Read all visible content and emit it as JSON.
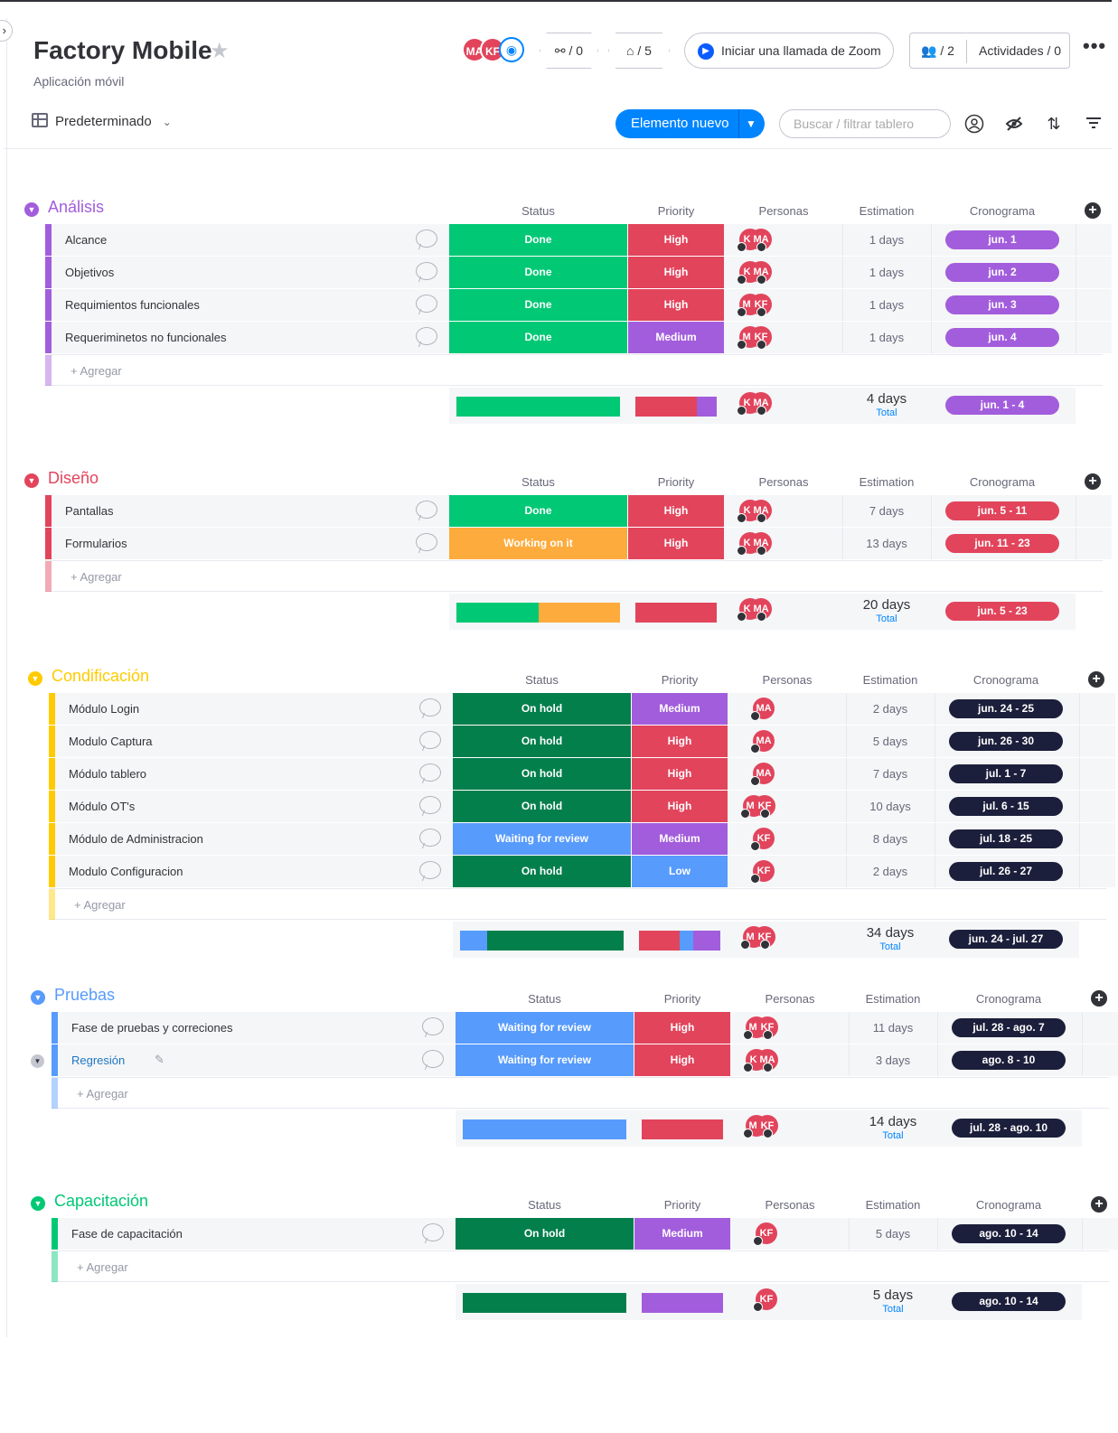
{
  "header": {
    "title": "Factory Mobile",
    "subtitle": "Aplicación móvil",
    "avatars": [
      "MA",
      "KF"
    ],
    "integrations_count": "/ 0",
    "automations_count": "/ 5",
    "zoom_label": "Iniciar una llamada de Zoom",
    "members_label": "/ 2",
    "activity_label": "Actividades / 0",
    "view_label": "Predeterminado",
    "new_item_label": "Elemento nuevo",
    "search_placeholder": "Buscar / filtrar tablero"
  },
  "columns": {
    "status": "Status",
    "priority": "Priority",
    "people": "Personas",
    "estimation": "Estimation",
    "timeline": "Cronograma"
  },
  "add_label": "+ Agregar",
  "total_label": "Total",
  "colors": {
    "done": "#00c875",
    "working": "#fdab3d",
    "onhold": "#037f4c",
    "review": "#579bfc",
    "high": "#e2445c",
    "medium": "#a25ddc",
    "low": "#579bfc",
    "group_purple": "#a25ddc",
    "group_red": "#e2445c",
    "group_yellow": "#ffcb00",
    "group_blue": "#579bfc",
    "group_green": "#00c875",
    "tl_dark": "#1c1f3b",
    "accent": "#0085ff"
  },
  "groups": [
    {
      "name": "Análisis",
      "items": [
        {
          "name": "Alcance",
          "status": "Done",
          "priority": "High",
          "people": [
            "KF",
            "MA"
          ],
          "estimation": "1 days",
          "timeline": "jun. 1"
        },
        {
          "name": "Objetivos",
          "status": "Done",
          "priority": "High",
          "people": [
            "KF",
            "MA"
          ],
          "estimation": "1 days",
          "timeline": "jun. 2"
        },
        {
          "name": "Requimientos funcionales",
          "status": "Done",
          "priority": "High",
          "people": [
            "MA",
            "KF"
          ],
          "estimation": "1 days",
          "timeline": "jun. 3"
        },
        {
          "name": "Requeriminetos no funcionales",
          "status": "Done",
          "priority": "Medium",
          "people": [
            "MA",
            "KF"
          ],
          "estimation": "1 days",
          "timeline": "jun. 4"
        }
      ],
      "summary": {
        "people": [
          "KF",
          "MA"
        ],
        "estimation": "4 days",
        "timeline": "jun. 1 - 4",
        "status_dist": [
          {
            "label": "Done",
            "fraction": 1.0
          }
        ],
        "priority_dist": [
          {
            "label": "High",
            "fraction": 0.75
          },
          {
            "label": "Medium",
            "fraction": 0.25
          }
        ]
      }
    },
    {
      "name": "Diseño",
      "items": [
        {
          "name": "Pantallas",
          "status": "Done",
          "priority": "High",
          "people": [
            "KF",
            "MA"
          ],
          "estimation": "7 days",
          "timeline": "jun. 5 - 11"
        },
        {
          "name": "Formularios",
          "status": "Working on it",
          "priority": "High",
          "people": [
            "KF",
            "MA"
          ],
          "estimation": "13 days",
          "timeline": "jun. 11 - 23"
        }
      ],
      "summary": {
        "people": [
          "KF",
          "MA"
        ],
        "estimation": "20 days",
        "timeline": "jun. 5 - 23",
        "status_dist": [
          {
            "label": "Done",
            "fraction": 0.5
          },
          {
            "label": "Working on it",
            "fraction": 0.5
          }
        ],
        "priority_dist": [
          {
            "label": "High",
            "fraction": 1.0
          }
        ]
      }
    },
    {
      "name": "Condificación",
      "items": [
        {
          "name": "Módulo Login",
          "status": "On hold",
          "priority": "Medium",
          "people": [
            "MA"
          ],
          "estimation": "2 days",
          "timeline": "jun. 24 - 25"
        },
        {
          "name": "Modulo Captura",
          "status": "On hold",
          "priority": "High",
          "people": [
            "MA"
          ],
          "estimation": "5 days",
          "timeline": "jun. 26 - 30"
        },
        {
          "name": "Módulo tablero",
          "status": "On hold",
          "priority": "High",
          "people": [
            "MA"
          ],
          "estimation": "7 days",
          "timeline": "jul. 1 - 7"
        },
        {
          "name": "Módulo OT's",
          "status": "On hold",
          "priority": "High",
          "people": [
            "MA",
            "KF"
          ],
          "estimation": "10 days",
          "timeline": "jul. 6 - 15"
        },
        {
          "name": "Módulo de Administracion",
          "status": "Waiting for review",
          "priority": "Medium",
          "people": [
            "KF"
          ],
          "estimation": "8 days",
          "timeline": "jul. 18 - 25"
        },
        {
          "name": "Modulo Configuracion",
          "status": "On hold",
          "priority": "Low",
          "people": [
            "KF"
          ],
          "estimation": "2 days",
          "timeline": "jul. 26 - 27"
        }
      ],
      "summary": {
        "people": [
          "MA",
          "KF"
        ],
        "estimation": "34 days",
        "timeline": "jun. 24 - jul. 27",
        "status_dist": [
          {
            "label": "Waiting for review",
            "fraction": 0.1667
          },
          {
            "label": "On hold",
            "fraction": 0.8333
          }
        ],
        "priority_dist": [
          {
            "label": "High",
            "fraction": 0.5
          },
          {
            "label": "Low",
            "fraction": 0.1667
          },
          {
            "label": "Medium",
            "fraction": 0.3333
          }
        ]
      }
    },
    {
      "name": "Pruebas",
      "items": [
        {
          "name": "Fase de pruebas y correciones",
          "status": "Waiting for review",
          "priority": "High",
          "people": [
            "MA",
            "KF"
          ],
          "estimation": "11 days",
          "timeline": "jul. 28 - ago. 7"
        },
        {
          "name": "Regresión",
          "status": "Waiting for review",
          "priority": "High",
          "people": [
            "KF",
            "MA"
          ],
          "estimation": "3 days",
          "timeline": "ago. 8 - 10"
        }
      ],
      "summary": {
        "people": [
          "MA",
          "KF"
        ],
        "estimation": "14 days",
        "timeline": "jul. 28 - ago. 10",
        "status_dist": [
          {
            "label": "Waiting for review",
            "fraction": 1.0
          }
        ],
        "priority_dist": [
          {
            "label": "High",
            "fraction": 1.0
          }
        ]
      }
    },
    {
      "name": "Capacitación",
      "items": [
        {
          "name": "Fase de capacitación",
          "status": "On hold",
          "priority": "Medium",
          "people": [
            "KF"
          ],
          "estimation": "5 days",
          "timeline": "ago. 10 - 14"
        }
      ],
      "summary": {
        "people": [
          "KF"
        ],
        "estimation": "5 days",
        "timeline": "ago. 10 - 14",
        "status_dist": [
          {
            "label": "On hold",
            "fraction": 1.0
          }
        ],
        "priority_dist": [
          {
            "label": "Medium",
            "fraction": 1.0
          }
        ]
      }
    }
  ]
}
